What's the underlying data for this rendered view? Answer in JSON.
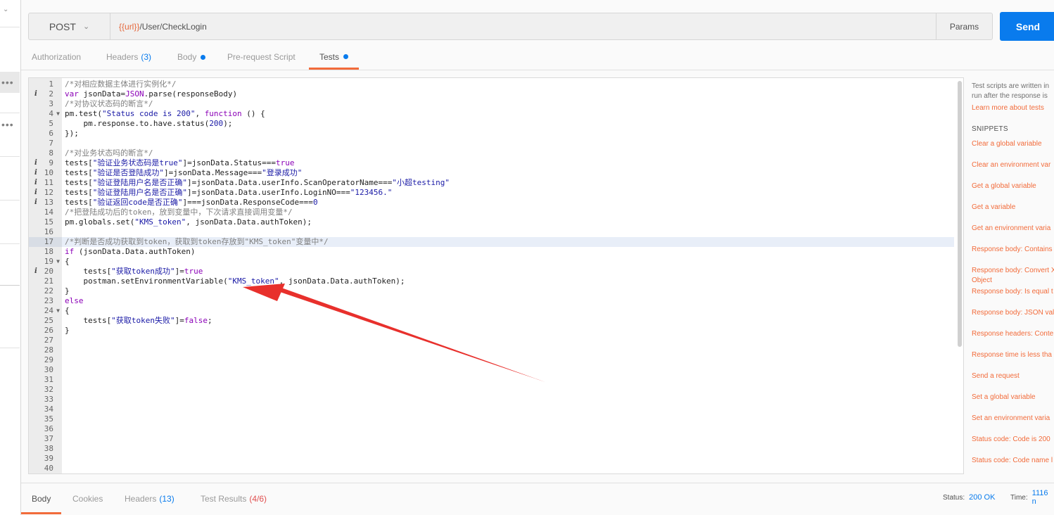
{
  "request": {
    "method": "POST",
    "url_var": "{{url}}",
    "url_path": "/User/CheckLogin",
    "params_label": "Params",
    "send_label": "Send"
  },
  "tabs": [
    {
      "label": "Authorization"
    },
    {
      "label": "Headers",
      "count": "(3)"
    },
    {
      "label": "Body"
    },
    {
      "label": "Pre-request Script"
    },
    {
      "label": "Tests"
    }
  ],
  "editor": {
    "highlighted_line": 17,
    "lines": [
      "/*对相应数据主体进行实例化*/",
      "var jsonData=JSON.parse(responseBody)",
      "/*对协议状态码的断言*/",
      "pm.test(\"Status code is 200\", function () {",
      "    pm.response.to.have.status(200);",
      "});",
      "",
      "/*对业务状态吗的断言*/",
      "tests[\"验证业务状态码是true\"]=jsonData.Status===true",
      "tests[\"验证是否登陆成功\"]=jsonData.Message===\"登录成功\"",
      "tests[\"验证登陆用户名是否正确\"]=jsonData.Data.userInfo.ScanOperatorName===\"小超testing\"",
      "tests[\"验证登陆用户名是否正确\"]=jsonData.Data.userInfo.LoginNO===\"123456.\"",
      "tests[\"验证返回code是否正确\"]===jsonData.ResponseCode===0",
      "/*把登陆成功后的token，放到变量中，下次请求直接调用变量*/",
      "pm.globals.set(\"KMS_token\", jsonData.Data.authToken);",
      "",
      "/*判断是否成功获取到token，获取到token存放到\"KMS_token\"变量中*/",
      "if (jsonData.Data.authToken)",
      "{",
      "    tests[\"获取token成功\"]=true",
      "    postman.setEnvironmentVariable(\"KMS_token\", jsonData.Data.authToken);",
      "}",
      "else",
      "{",
      "    tests[\"获取token失败\"]=false;",
      "}",
      "",
      "",
      "",
      "",
      "",
      "",
      "",
      "",
      "",
      "",
      "",
      "",
      "",
      ""
    ],
    "info_lines": [
      2,
      9,
      10,
      11,
      12,
      13,
      20
    ],
    "fold_lines": [
      4,
      19,
      24
    ]
  },
  "right_panel": {
    "intro_1": "Test scripts are written in",
    "intro_2": "run after the response is",
    "learn_link": "Learn more about tests",
    "snippets_heading": "SNIPPETS",
    "snippets": [
      "Clear a global variable",
      "Clear an environment var",
      "Get a global variable",
      "Get a variable",
      "Get an environment varia",
      "Response body: Contains",
      "Response body: Convert X",
      "Object",
      "Response body: Is equal t",
      "Response body: JSON valu",
      "Response headers: Conte",
      "Response time is less tha",
      "Send a request",
      "Set a global variable",
      "Set an environment varia",
      "Status code: Code is 200",
      "Status code: Code name l"
    ]
  },
  "response_tabs": [
    {
      "label": "Body"
    },
    {
      "label": "Cookies"
    },
    {
      "label": "Headers",
      "count": "(13)"
    },
    {
      "label": "Test Results",
      "count": "(4/6)"
    }
  ],
  "response_status": {
    "status_label": "Status:",
    "status_value": "200 OK",
    "time_label": "Time:",
    "time_value": "1116 n"
  },
  "colors": {
    "accent": "#f26b3a",
    "send": "#097bed",
    "annotation_arrow": "#e8302c"
  }
}
